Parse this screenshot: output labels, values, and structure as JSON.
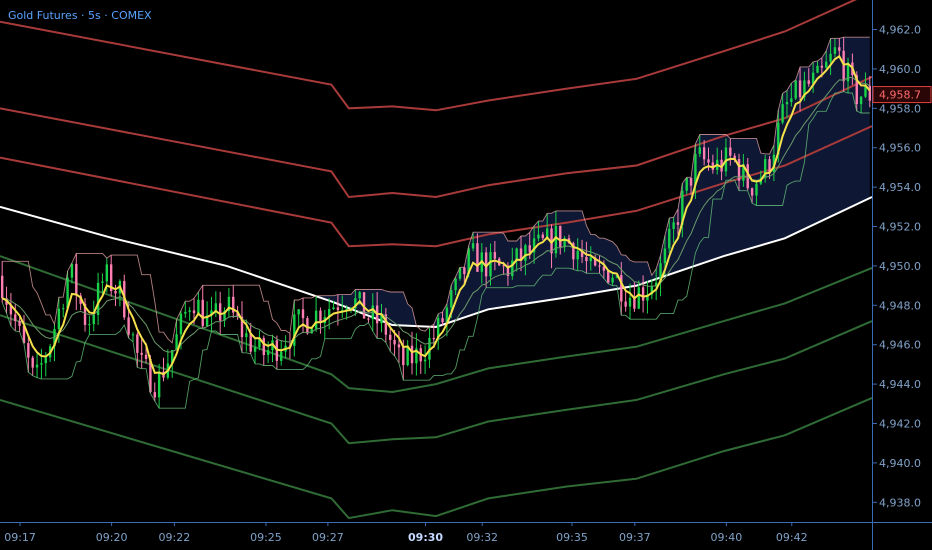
{
  "header": {
    "title": "Gold Futures · 5s · COMEX"
  },
  "colors": {
    "background": "#000000",
    "axis": "#3a6cb8",
    "tick_text": "#7fa1c8",
    "up": "#19d24a",
    "down": "#ff7fb3",
    "resistance": "#a83a3a",
    "support": "#2f6b35",
    "vwap": "#ffffff",
    "ema": "#f3e04a",
    "envelope_upper": "#e0a0a0",
    "envelope_lower": "#66c27a",
    "fill": "#0f1a3a",
    "price_box": "#e04040"
  },
  "chart_data": {
    "type": "candlestick",
    "ylim": [
      4937,
      4963.5
    ],
    "xlim": [
      0,
      100
    ],
    "y_ticks": [
      "4,938.0",
      "4,940.0",
      "4,942.0",
      "4,944.0",
      "4,946.0",
      "4,948.0",
      "4,950.0",
      "4,952.0",
      "4,954.0",
      "4,956.0",
      "4,958.0",
      "4,960.0",
      "4,962.0"
    ],
    "y_tick_values": [
      4938,
      4940,
      4942,
      4944,
      4946,
      4948,
      4950,
      4952,
      4954,
      4956,
      4958,
      4960,
      4962
    ],
    "x_ticks": [
      "09:17",
      "09:20",
      "09:22",
      "09:25",
      "09:27",
      "09:30",
      "09:32",
      "09:35",
      "09:37",
      "09:40",
      "09:42"
    ],
    "x_tick_values": [
      2.3,
      12.8,
      20.0,
      30.5,
      37.6,
      48.8,
      55.3,
      65.6,
      72.8,
      83.3,
      90.8
    ],
    "x_tick_bold": "09:30",
    "last_price": "4,958.7",
    "last_price_value": 4958.7,
    "candle_count": 200,
    "price_path": [
      [
        0,
        4949.5
      ],
      [
        2,
        4946.8
      ],
      [
        4,
        4944.0
      ],
      [
        6,
        4946.5
      ],
      [
        8,
        4949.8
      ],
      [
        10,
        4947.0
      ],
      [
        12,
        4949.5
      ],
      [
        14,
        4948.5
      ],
      [
        16,
        4945.0
      ],
      [
        18,
        4944.0
      ],
      [
        20,
        4946.0
      ],
      [
        22,
        4948.5
      ],
      [
        24,
        4947.0
      ],
      [
        26,
        4948.0
      ],
      [
        28,
        4946.5
      ],
      [
        30,
        4945.5
      ],
      [
        32,
        4946.0
      ],
      [
        34,
        4947.0
      ],
      [
        36,
        4947.5
      ],
      [
        38,
        4948.0
      ],
      [
        40,
        4948.5
      ],
      [
        42,
        4947.5
      ],
      [
        44,
        4947.0
      ],
      [
        46,
        4945.0
      ],
      [
        48,
        4945.5
      ],
      [
        50,
        4946.5
      ],
      [
        52,
        4948.5
      ],
      [
        54,
        4950.5
      ],
      [
        56,
        4950.0
      ],
      [
        58,
        4949.8
      ],
      [
        60,
        4950.5
      ],
      [
        62,
        4951.0
      ],
      [
        64,
        4951.5
      ],
      [
        66,
        4951.0
      ],
      [
        68,
        4949.5
      ],
      [
        70,
        4949.8
      ],
      [
        72,
        4948.5
      ],
      [
        74,
        4948.8
      ],
      [
        76,
        4950.0
      ],
      [
        78,
        4953.0
      ],
      [
        80,
        4955.5
      ],
      [
        82,
        4955.0
      ],
      [
        84,
        4955.5
      ],
      [
        86,
        4954.0
      ],
      [
        88,
        4955.0
      ],
      [
        90,
        4958.0
      ],
      [
        92,
        4959.0
      ],
      [
        94,
        4959.5
      ],
      [
        96,
        4961.0
      ],
      [
        98,
        4958.7
      ],
      [
        100,
        4958.7
      ]
    ],
    "series": [
      {
        "name": "",
        "kind": "vwap",
        "points": [
          [
            0,
            4953.0
          ],
          [
            13,
            4951.4
          ],
          [
            26,
            4950.0
          ],
          [
            38,
            4948.2
          ],
          [
            45,
            4947.0
          ],
          [
            50,
            4946.9
          ],
          [
            56,
            4947.8
          ],
          [
            65,
            4948.4
          ],
          [
            73,
            4949.0
          ],
          [
            83,
            4950.5
          ],
          [
            90,
            4951.4
          ],
          [
            100,
            4953.5
          ]
        ]
      },
      {
        "name": "",
        "kind": "resistance",
        "points": [
          [
            0,
            4962.4
          ],
          [
            38,
            4959.2
          ],
          [
            40,
            4958.0
          ],
          [
            45,
            4958.1
          ],
          [
            50,
            4957.9
          ],
          [
            56,
            4958.4
          ],
          [
            65,
            4959.0
          ],
          [
            73,
            4959.5
          ],
          [
            83,
            4960.9
          ],
          [
            90,
            4961.9
          ],
          [
            100,
            4963.9
          ]
        ]
      },
      {
        "name": "",
        "kind": "resistance",
        "points": [
          [
            0,
            4958.0
          ],
          [
            38,
            4954.8
          ],
          [
            40,
            4953.5
          ],
          [
            45,
            4953.7
          ],
          [
            50,
            4953.5
          ],
          [
            56,
            4954.1
          ],
          [
            65,
            4954.7
          ],
          [
            73,
            4955.1
          ],
          [
            83,
            4956.6
          ],
          [
            90,
            4957.5
          ],
          [
            100,
            4959.6
          ]
        ]
      },
      {
        "name": "",
        "kind": "resistance",
        "points": [
          [
            0,
            4955.5
          ],
          [
            38,
            4952.2
          ],
          [
            40,
            4951.0
          ],
          [
            45,
            4951.1
          ],
          [
            50,
            4951.0
          ],
          [
            56,
            4951.6
          ],
          [
            65,
            4952.2
          ],
          [
            73,
            4952.8
          ],
          [
            83,
            4954.2
          ],
          [
            90,
            4955.1
          ],
          [
            100,
            4957.1
          ]
        ]
      },
      {
        "name": "",
        "kind": "support",
        "points": [
          [
            0,
            4950.5
          ],
          [
            38,
            4944.5
          ],
          [
            40,
            4943.8
          ],
          [
            45,
            4943.6
          ],
          [
            50,
            4944.0
          ],
          [
            56,
            4944.8
          ],
          [
            65,
            4945.4
          ],
          [
            73,
            4945.9
          ],
          [
            83,
            4947.2
          ],
          [
            90,
            4948.1
          ],
          [
            100,
            4949.9
          ]
        ]
      },
      {
        "name": "",
        "kind": "support",
        "points": [
          [
            0,
            4947.5
          ],
          [
            38,
            4942.0
          ],
          [
            40,
            4941.0
          ],
          [
            45,
            4941.2
          ],
          [
            50,
            4941.3
          ],
          [
            56,
            4942.1
          ],
          [
            65,
            4942.7
          ],
          [
            73,
            4943.2
          ],
          [
            83,
            4944.5
          ],
          [
            90,
            4945.3
          ],
          [
            100,
            4947.2
          ]
        ]
      },
      {
        "name": "",
        "kind": "support",
        "points": [
          [
            0,
            4943.2
          ],
          [
            38,
            4938.2
          ],
          [
            40,
            4937.2
          ],
          [
            45,
            4937.6
          ],
          [
            50,
            4937.3
          ],
          [
            56,
            4938.2
          ],
          [
            65,
            4938.8
          ],
          [
            73,
            4939.2
          ],
          [
            83,
            4940.6
          ],
          [
            90,
            4941.4
          ],
          [
            100,
            4943.3
          ]
        ]
      }
    ]
  }
}
